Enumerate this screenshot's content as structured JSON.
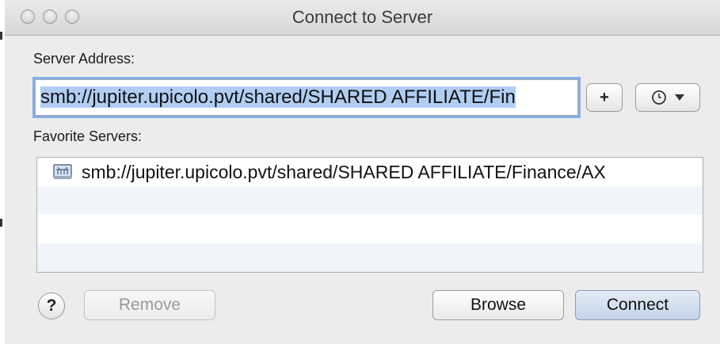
{
  "window": {
    "title": "Connect to Server"
  },
  "server_address": {
    "label": "Server Address:",
    "value": "smb://jupiter.upicolo.pvt/shared/SHARED AFFILIATE/Fin"
  },
  "favorites": {
    "label": "Favorite Servers:",
    "items": [
      {
        "text": "smb://jupiter.upicolo.pvt/shared/SHARED AFFILIATE/Finance/AX",
        "icon": "network-server-icon"
      },
      {
        "text": "",
        "icon": ""
      },
      {
        "text": "",
        "icon": ""
      },
      {
        "text": "",
        "icon": ""
      }
    ]
  },
  "buttons": {
    "add": "+",
    "help": "?",
    "remove": "Remove",
    "browse": "Browse",
    "connect": "Connect"
  },
  "icons": {
    "add": "plus-icon",
    "recent": "clock-icon",
    "recent_menu": "dropdown-triangle-icon",
    "help": "question-mark-icon"
  },
  "colors": {
    "selection": "#b1cdf2",
    "focus_ring": "#84aee8",
    "default_button": "#c4d4e8"
  }
}
